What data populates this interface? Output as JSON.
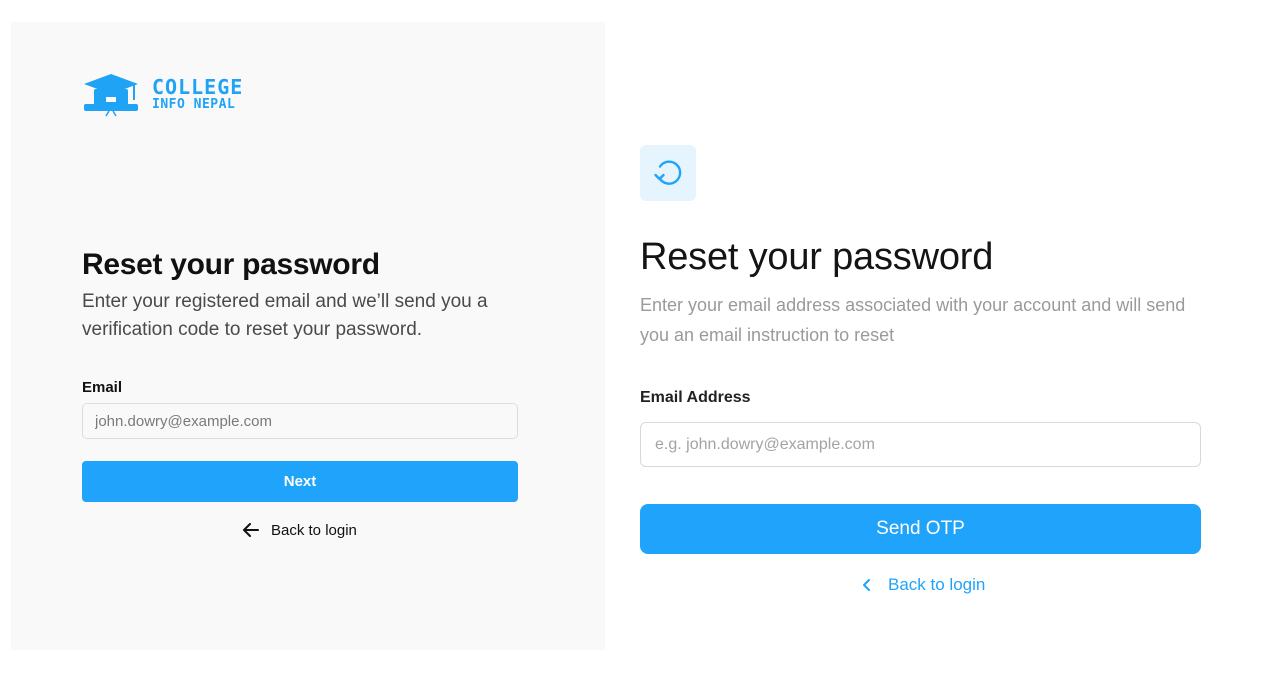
{
  "left": {
    "logo": {
      "line1": "COLLEGE",
      "line2": "INFO NEPAL"
    },
    "title": "Reset your password",
    "subtitle": "Enter your registered email and we’ll send you a verification code to reset your password.",
    "email_label": "Email",
    "email_placeholder": "john.dowry@example.com",
    "email_value": "",
    "next_label": "Next",
    "back_label": "Back to login",
    "back_icon": "arrow-left-icon"
  },
  "right": {
    "header_icon": "refresh-icon",
    "title": "Reset your password",
    "subtitle": "Enter your email address associated with your account and will send you an email instruction to reset",
    "email_label": "Email Address",
    "email_placeholder": "e.g. john.dowry@example.com",
    "email_value": "",
    "send_label": "Send OTP",
    "back_label": "Back to login",
    "back_icon": "chevron-left-icon"
  },
  "colors": {
    "accent": "#1fa3fb",
    "left_panel_bg": "#f9f9f9",
    "icon_box_bg": "#e6f4fd",
    "muted_text": "#9a9a9a"
  }
}
